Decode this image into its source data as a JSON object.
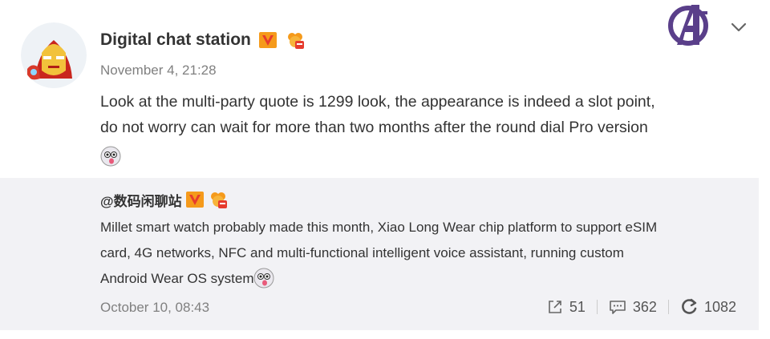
{
  "post": {
    "author": "Digital chat station",
    "time": "November 4, 21:28",
    "text_lines": [
      "Look at the multi-party quote is 1299 look, the appearance is indeed a slot point,",
      "do not worry can wait for more than two months after the round dial Pro version"
    ]
  },
  "repost": {
    "author": "@数码闲聊站",
    "text_lines": [
      "Millet smart watch probably made this month, Xiao Long Wear chip platform to support eSIM",
      "card, 4G networks, NFC and multi-functional intelligent voice assistant, running custom",
      "Android Wear OS system"
    ],
    "time": "October 10, 08:43",
    "actions": {
      "share": "51",
      "comment": "362",
      "like": "1082"
    }
  },
  "icons": {
    "avatar": "iron-man-avatar",
    "verified": "v-badge-icon",
    "medal": "medal-icon",
    "emoji": "emoji-face-icon",
    "logo": "avengers-logo",
    "dropdown": "chevron-down-icon",
    "share": "share-icon",
    "comment": "comment-icon",
    "like": "like-icon"
  },
  "colors": {
    "badge_orange": "#f59a1b",
    "badge_red": "#e63b2e",
    "repost_bg": "#f2f2f5",
    "text_primary": "#333333",
    "text_muted": "#808080",
    "logo_purple": "#5a3f8a"
  }
}
